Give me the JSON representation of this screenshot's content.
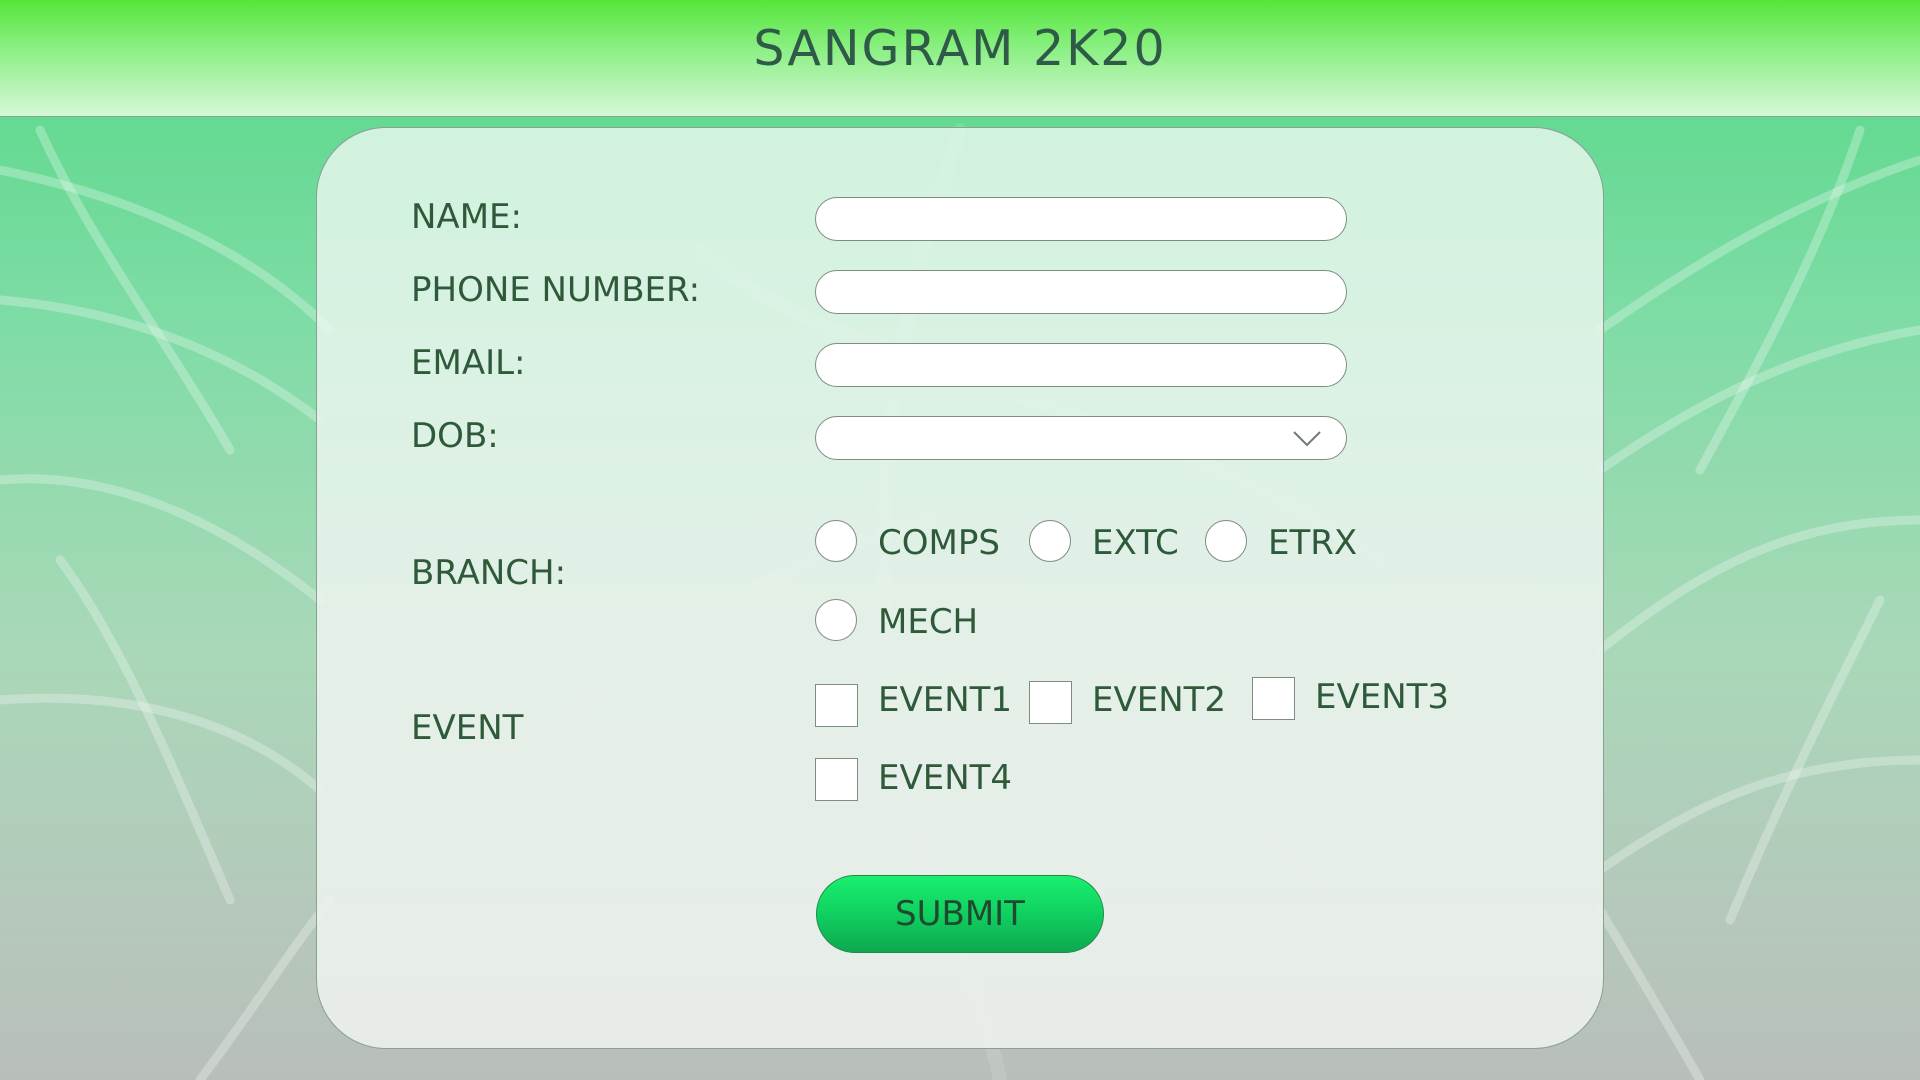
{
  "header": {
    "title": "SANGRAM 2K20"
  },
  "form": {
    "name": {
      "label": "NAME:",
      "value": ""
    },
    "phone": {
      "label": "PHONE NUMBER:",
      "value": ""
    },
    "email": {
      "label": "EMAIL:",
      "value": ""
    },
    "dob": {
      "label": "DOB:",
      "value": ""
    },
    "branch": {
      "label": "BRANCH:",
      "options": [
        "COMPS",
        "EXTC",
        "ETRX",
        "MECH"
      ],
      "selected": null
    },
    "event": {
      "label": "EVENT",
      "options": [
        "EVENT1",
        "EVENT2",
        "EVENT3",
        "EVENT4"
      ],
      "checked": []
    },
    "submit_label": "SUBMIT"
  },
  "colors": {
    "header_top": "#55e63a",
    "accent_button": "#10d060",
    "text": "#2f5a3a"
  },
  "icons": {
    "dob_dropdown": "chevron-down-icon"
  }
}
